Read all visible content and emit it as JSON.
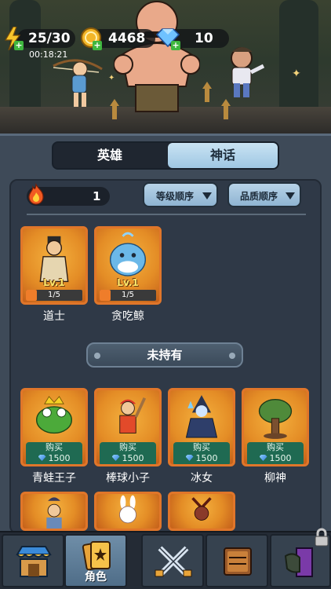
{
  "resources": {
    "energy": "25/30",
    "energy_timer": "00:18:21",
    "coins": "4468",
    "gems": "10"
  },
  "tabs": [
    {
      "label": "英雄",
      "active": false
    },
    {
      "label": "神话",
      "active": true
    }
  ],
  "fire_count": "1",
  "sort": {
    "level": "等级顺序",
    "quality": "品质顺序"
  },
  "owned": [
    {
      "name": "道士",
      "level": "Lv.1",
      "progress": "1/5",
      "progress_fraction": 0.2
    },
    {
      "name": "贪吃鲸",
      "level": "Lv.1",
      "progress": "1/5",
      "progress_fraction": 0.2
    }
  ],
  "unowned_label": "未持有",
  "shop": [
    {
      "name": "青蛙王子",
      "buy_label": "购买",
      "price": "1500"
    },
    {
      "name": "棒球小子",
      "buy_label": "购买",
      "price": "1500"
    },
    {
      "name": "冰女",
      "buy_label": "购买",
      "price": "1500"
    },
    {
      "name": "柳神",
      "buy_label": "购买",
      "price": "1500"
    }
  ],
  "nav": {
    "active_label": "角色"
  },
  "colors": {
    "card_border": "#e0762a",
    "buy_green": "#1f6a52",
    "active_tab": "#b7d3e8"
  }
}
